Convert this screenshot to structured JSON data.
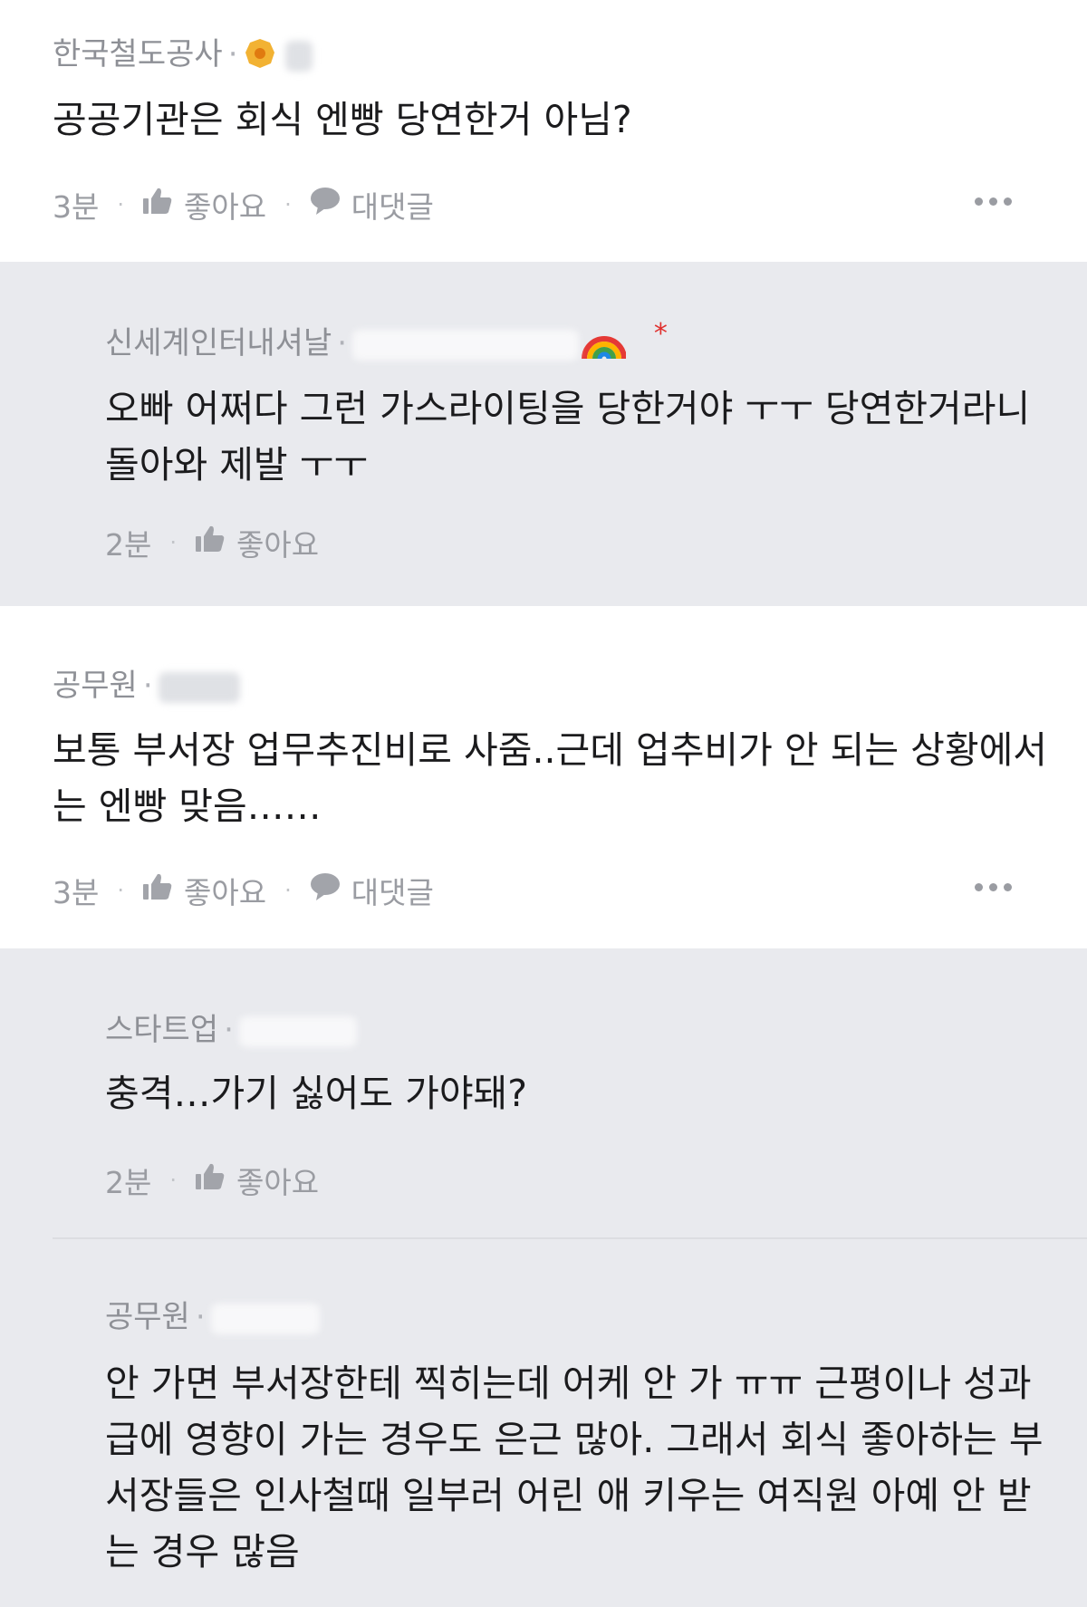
{
  "comments": [
    {
      "company": "한국철도공사",
      "body": [
        "공공기관은 회식 엔빵 당연한거 아님?"
      ],
      "time": "3분",
      "like_label": "좋아요",
      "reply_label": "대댓글"
    },
    {
      "company": "신세계인터내셔날",
      "body": [
        "오빠 어쩌다 그런 가스라이팅을 당한거야 ㅜㅜ 당연한거라니",
        "돌아와 제발 ㅜㅜ"
      ],
      "time": "2분",
      "like_label": "좋아요"
    },
    {
      "company": "공무원",
      "body": [
        "보통 부서장 업무추진비로 사줌..근데 업추비가 안 되는 상황에서",
        "는 엔빵 맞음……"
      ],
      "time": "3분",
      "like_label": "좋아요",
      "reply_label": "대댓글"
    },
    {
      "company": "스타트업",
      "body": [
        "충격…가기 싫어도 가야돼?"
      ],
      "time": "2분",
      "like_label": "좋아요"
    },
    {
      "company": "공무원",
      "body": [
        "안 가면 부서장한테 찍히는데 어케 안 가 ㅠㅠ 근평이나 성과",
        "급에 영향이 가는 경우도 은근 많아. 그래서 회식 좋아하는 부",
        "서장들은 인사철때 일부러 어린 애 키우는 여직원 아예 안 받",
        "는 경우 많음"
      ]
    }
  ],
  "icons": {
    "like": "thumbs-up-icon",
    "reply": "speech-bubble-icon",
    "more": "more-dots-icon",
    "badge": "orange-badge-icon",
    "rainbow": "rainbow-emoji-icon"
  },
  "colors": {
    "top_bg": "#ffffff",
    "reply_bg": "#e9eaee",
    "meta_text": "#8e9096",
    "body_text": "#1b1b1d"
  }
}
